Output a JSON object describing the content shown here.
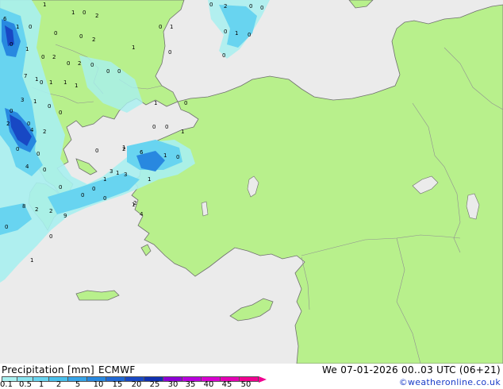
{
  "footer": {
    "title": "Precipitation [mm]",
    "model": "ECMWF",
    "valid_time": "We 07-01-2026 00..03 UTC (06+21)",
    "credit": "©weatheronline.co.uk"
  },
  "legend": {
    "ticks": [
      "0.1",
      "0.5",
      "1",
      "2",
      "5",
      "10",
      "15",
      "20",
      "25",
      "30",
      "35",
      "40",
      "45",
      "50"
    ],
    "colors": [
      "#a8f0f0",
      "#88e4f0",
      "#68d4f0",
      "#48c0ec",
      "#36a4e8",
      "#2888e0",
      "#2068d4",
      "#1848c4",
      "#1030b0",
      "#8c00d4",
      "#b800dc",
      "#d800d0",
      "#e400b4",
      "#f00090"
    ]
  },
  "colors": {
    "sea": "#ebebeb",
    "land": "#b8f08c",
    "coast": "#6f6f6f",
    "border": "#909090"
  },
  "map": {
    "point_values": [
      "6",
      "1",
      "1",
      "0",
      "2",
      "1",
      "0",
      "0",
      "0",
      "2",
      "0",
      "1",
      "0",
      "1",
      "0",
      "2",
      "0",
      "2",
      "0",
      "1",
      "0",
      "7",
      "1",
      "0",
      "1",
      "1",
      "1",
      "0",
      "0",
      "3",
      "1",
      "0",
      "0",
      "0",
      "0",
      "2",
      "4",
      "2",
      "0",
      "0",
      "0",
      "4",
      "0",
      "2",
      "6",
      "1",
      "0",
      "1",
      "0",
      "0",
      "1",
      "1",
      "0",
      "8",
      "2",
      "2",
      "9",
      "3",
      "3",
      "1",
      "0",
      "0",
      "1",
      "0",
      "2",
      "4",
      "0",
      "2",
      "0",
      "0",
      "0",
      "1",
      "0",
      "0",
      "0",
      "0",
      "1",
      "1",
      "0",
      "1"
    ]
  }
}
